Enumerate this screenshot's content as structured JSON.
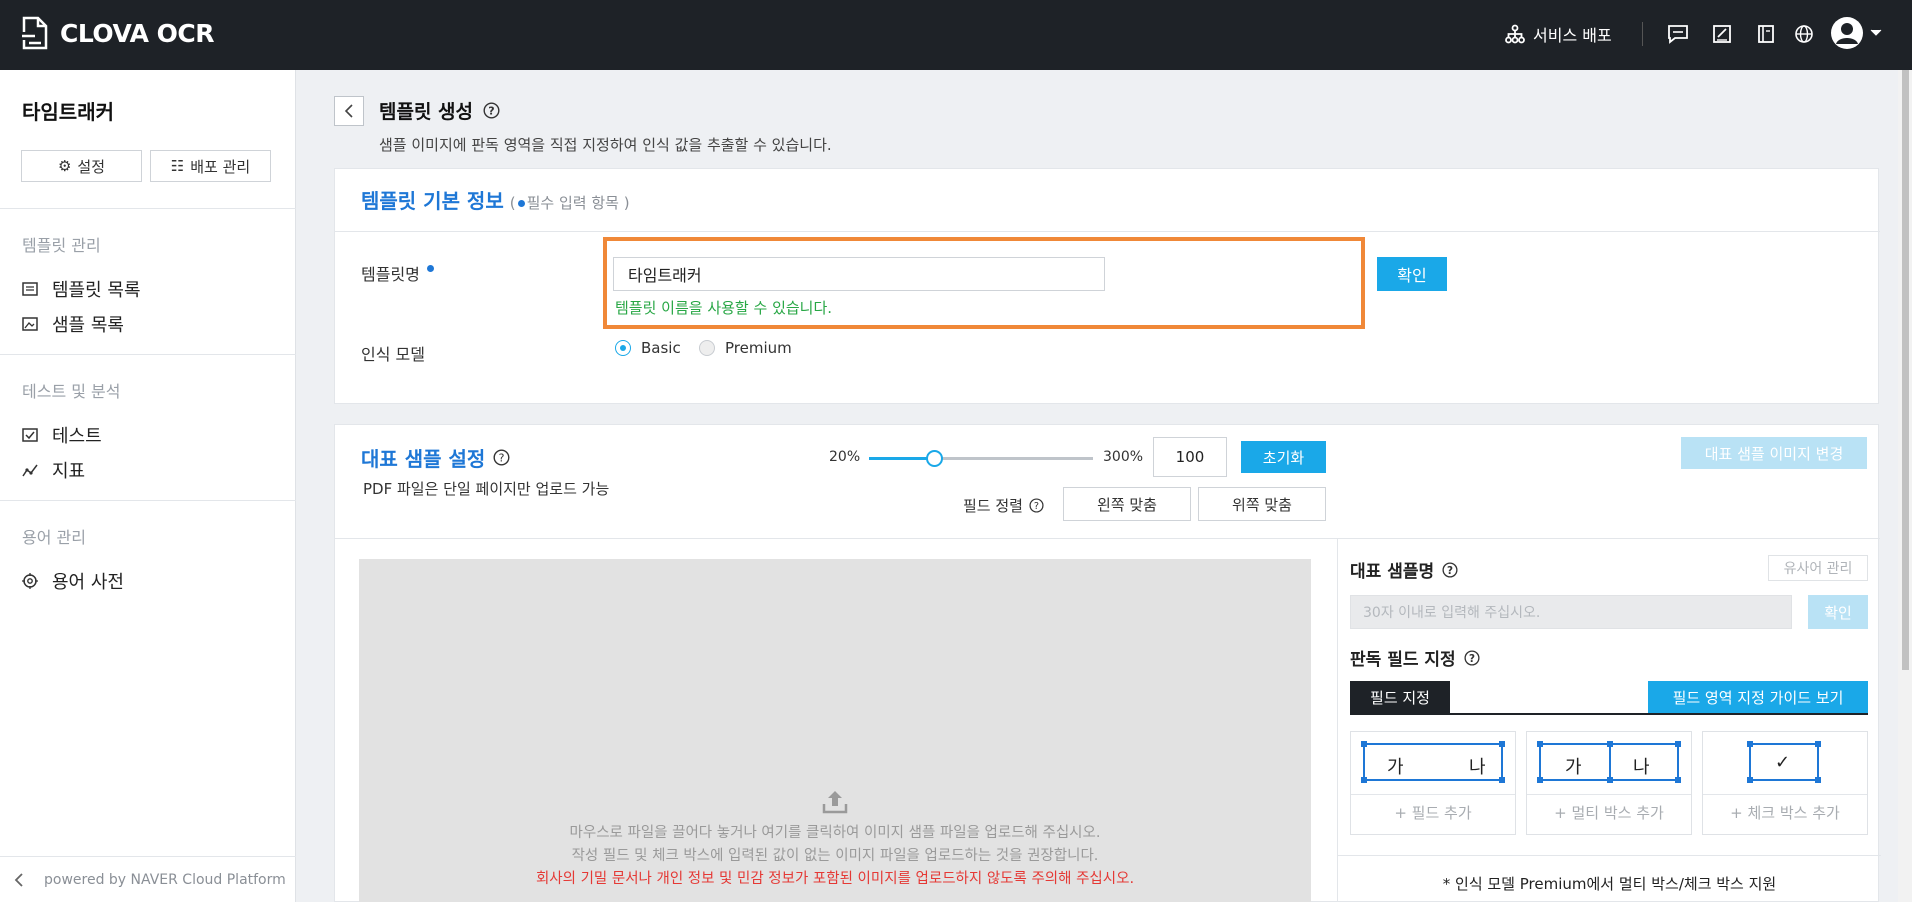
{
  "app": {
    "brand": "CLOVA OCR"
  },
  "topbar": {
    "service_deploy": "서비스 배포",
    "icons": [
      "chat-icon",
      "edit-note-icon",
      "book-icon",
      "globe-icon",
      "user-avatar-icon"
    ]
  },
  "sidebar": {
    "project_name": "타임트래커",
    "settings_btn": "설정",
    "deploy_mgmt_btn": "배포 관리",
    "sections": [
      {
        "title": "템플릿 관리",
        "items": [
          {
            "label": "템플릿 목록",
            "icon": "list-icon"
          },
          {
            "label": "샘플 목록",
            "icon": "image-icon"
          }
        ]
      },
      {
        "title": "테스트 및 분석",
        "items": [
          {
            "label": "테스트",
            "icon": "test-icon"
          },
          {
            "label": "지표",
            "icon": "chart-icon"
          }
        ]
      },
      {
        "title": "용어 관리",
        "items": [
          {
            "label": "용어 사전",
            "icon": "dictionary-icon"
          }
        ]
      }
    ],
    "footer": "powered by NAVER Cloud Platform"
  },
  "header": {
    "title": "템플릿 생성",
    "description": "샘플 이미지에 판독 영역을 직접 지정하여 인식 값을 추출할 수 있습니다."
  },
  "basic_info": {
    "title": "템플릿 기본 정보",
    "required_note_open": "(",
    "required_note": "필수 입력 항목 )",
    "name_label": "템플릿명",
    "name_value": "타임트래커",
    "confirm": "확인",
    "name_ok_msg": "템플릿 이름을 사용할 수 있습니다.",
    "model_label": "인식 모델",
    "model_options": [
      "Basic",
      "Premium"
    ],
    "model_selected": "Basic"
  },
  "sample_setting": {
    "title": "대표 샘플 설정",
    "pdf_note": "PDF 파일은 단일 페이지만 업로드 가능",
    "zoom_min": "20%",
    "zoom_max": "300%",
    "zoom_value": "100",
    "zoom_level_fraction": 0.29,
    "reset": "초기화",
    "change_image": "대표 샘플 이미지 변경",
    "field_align_label": "필드 정렬",
    "align_left": "왼쪽 맞춤",
    "align_top": "위쪽 맞춤",
    "dropzone": {
      "line1": "마우스로 파일을 끌어다 놓거나 여기를 클릭하여 이미지 샘플 파일을 업로드해 주십시오.",
      "line2": "작성 필드 및 체크 박스에 입력된 값이 없는 이미지 파일을 업로드하는 것을 권장합니다.",
      "warning": "회사의 기밀 문서나 개인 정보 및 민감 정보가 포함된 이미지를 업로드하지 않도록 주의해 주십시오."
    }
  },
  "right_panel": {
    "sample_name_title": "대표 샘플명",
    "synonym_mgmt": "유사어 관리",
    "sample_name_placeholder": "30자 이내로 입력해 주십시오.",
    "confirm": "확인",
    "field_title": "판독 필드 지정",
    "tab_field": "필드 지정",
    "guide_btn": "필드 영역 지정 가이드 보기",
    "tools": [
      {
        "glyph_a": "가",
        "glyph_b": "나",
        "label": "+ 필드 추가"
      },
      {
        "glyph_a": "가",
        "glyph_b": "나",
        "label": "+ 멀티 박스 추가"
      },
      {
        "glyph_a": "✓",
        "label": "+ 체크 박스 추가"
      }
    ],
    "premium_note": "* 인식 모델 Premium에서 멀티 박스/체크 박스 지원"
  },
  "colors": {
    "accent": "#1aa8e8",
    "title_blue": "#1e77d6",
    "highlight": "#f08838",
    "success": "#28a745",
    "warning": "#e53935",
    "topbar": "#1e2227"
  }
}
